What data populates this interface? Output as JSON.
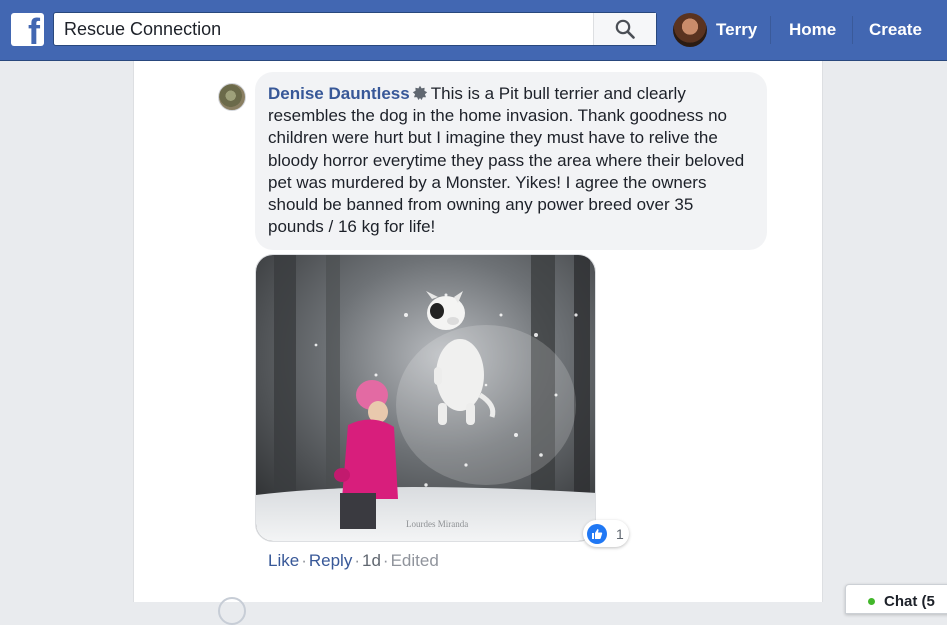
{
  "header": {
    "search_value": "Rescue Connection",
    "profile_name": "Terry",
    "nav_home": "Home",
    "nav_create": "Create"
  },
  "comment": {
    "author": "Denise Dauntless",
    "text": "This is a Pit bull terrier and clearly resembles the dog in the home invasion. Thank goodness no children were hurt but I imagine they must have to relive the bloody horror everytime they pass the area where their beloved pet was murdered by a Monster. Yikes! I agree the owners should be banned from owning any power breed over 35 pounds / 16 kg for life!",
    "reaction_count": "1",
    "like_label": "Like",
    "reply_label": "Reply",
    "time": "1d",
    "edited_label": "Edited",
    "photo_watermark": "Lourdes Miranda"
  },
  "chat": {
    "label": "Chat (5"
  },
  "colors": {
    "brand_blue": "#4267b2",
    "link_blue": "#385898",
    "like_blue": "#2078f4",
    "online_green": "#42b72a"
  }
}
